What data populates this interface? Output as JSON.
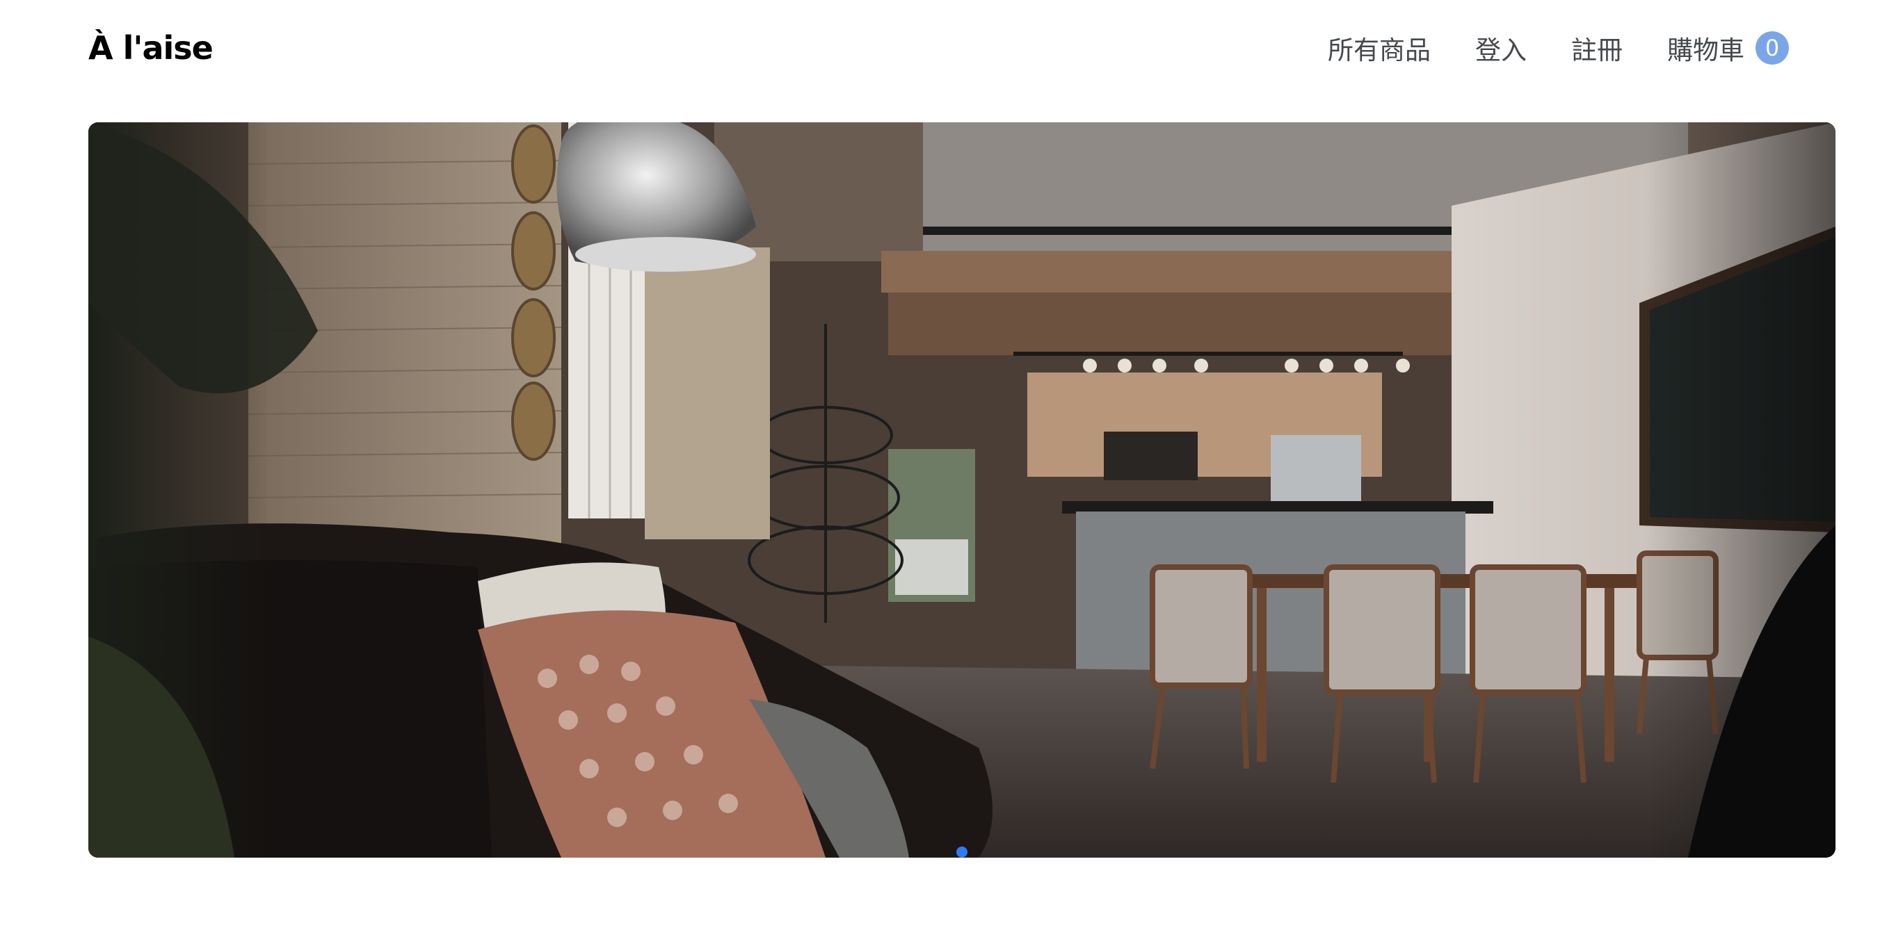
{
  "brand": {
    "name": "À l'aise"
  },
  "nav": {
    "products": "所有商品",
    "login": "登入",
    "register": "註冊",
    "cart": "購物車",
    "cart_count": "0"
  },
  "carousel": {
    "slides": 1,
    "active_index": 0
  },
  "icons": {
    "cart_badge": "count-badge"
  },
  "colors": {
    "badge": "#7aa5e8",
    "indicator_active": "#2f7bf5",
    "nav_text": "#45484d"
  }
}
